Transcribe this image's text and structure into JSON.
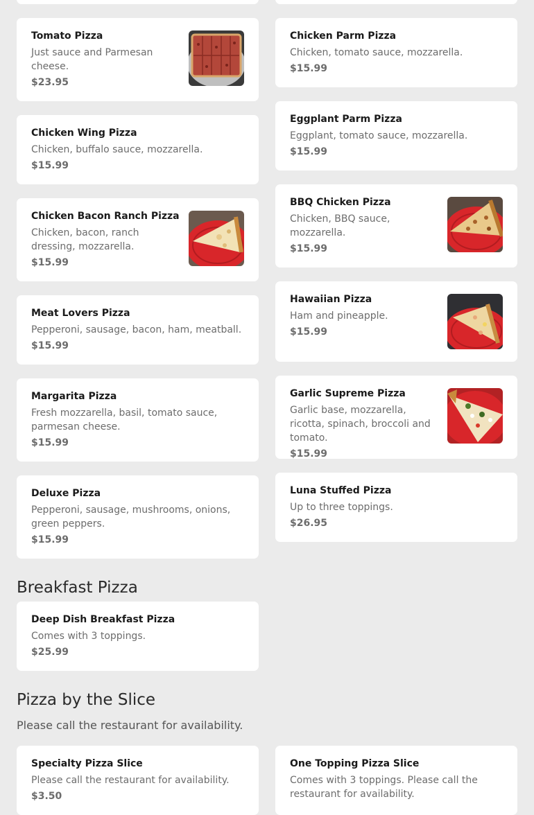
{
  "menu": {
    "pizzas": [
      {
        "title": "Tomato Pizza",
        "desc": "Just sauce and Parmesan cheese.",
        "price": "$23.95",
        "image": "tomato-pizza-photo"
      },
      {
        "title": "Chicken Wing Pizza",
        "desc": "Chicken, buffalo sauce, mozzarella.",
        "price": "$15.99"
      },
      {
        "title": "Chicken Bacon Ranch Pizza",
        "desc": "Chicken, bacon, ranch dressing, mozzarella.",
        "price": "$15.99",
        "image": "pizza-slice-photo"
      },
      {
        "title": "Meat Lovers Pizza",
        "desc": "Pepperoni, sausage, bacon, ham, meatball.",
        "price": "$15.99"
      },
      {
        "title": "Margarita Pizza",
        "desc": "Fresh mozzarella, basil, tomato sauce, parmesan cheese.",
        "price": "$15.99"
      },
      {
        "title": "Deluxe Pizza",
        "desc": "Pepperoni, sausage, mushrooms, onions, green peppers.",
        "price": "$15.99"
      },
      {
        "title": "Chicken Parm Pizza",
        "desc": "Chicken, tomato sauce, mozzarella.",
        "price": "$15.99"
      },
      {
        "title": "Eggplant Parm Pizza",
        "desc": "Eggplant, tomato sauce, mozzarella.",
        "price": "$15.99"
      },
      {
        "title": "BBQ Chicken Pizza",
        "desc": "Chicken, BBQ sauce, mozzarella.",
        "price": "$15.99",
        "image": "pizza-slice-photo"
      },
      {
        "title": "Hawaiian Pizza",
        "desc": "Ham and pineapple.",
        "price": "$15.99",
        "image": "pizza-slice-photo"
      },
      {
        "title": "Garlic Supreme Pizza",
        "desc": "Garlic base, mozzarella, ricotta, spinach, broccoli and tomato.",
        "price": "$15.99",
        "image": "pizza-slice-photo"
      },
      {
        "title": "Luna Stuffed Pizza",
        "desc": "Up to three toppings.",
        "price": "$26.95"
      }
    ],
    "breakfast": {
      "heading": "Breakfast Pizza",
      "items": [
        {
          "title": "Deep Dish Breakfast Pizza",
          "desc": "Comes with 3 toppings.",
          "price": "$25.99"
        }
      ]
    },
    "slice": {
      "heading": "Pizza by the Slice",
      "subheading": "Please call the restaurant for availability.",
      "items": [
        {
          "title": "Specialty Pizza Slice",
          "desc": "Please call the restaurant for availability.",
          "price": "$3.50"
        },
        {
          "title": "One Topping Pizza Slice",
          "desc": "Comes with 3 toppings. Please call the restaurant for availability."
        }
      ]
    }
  },
  "colors": {
    "background": "#ebebeb",
    "card": "#ffffff",
    "plate_red": "#d8262a"
  }
}
